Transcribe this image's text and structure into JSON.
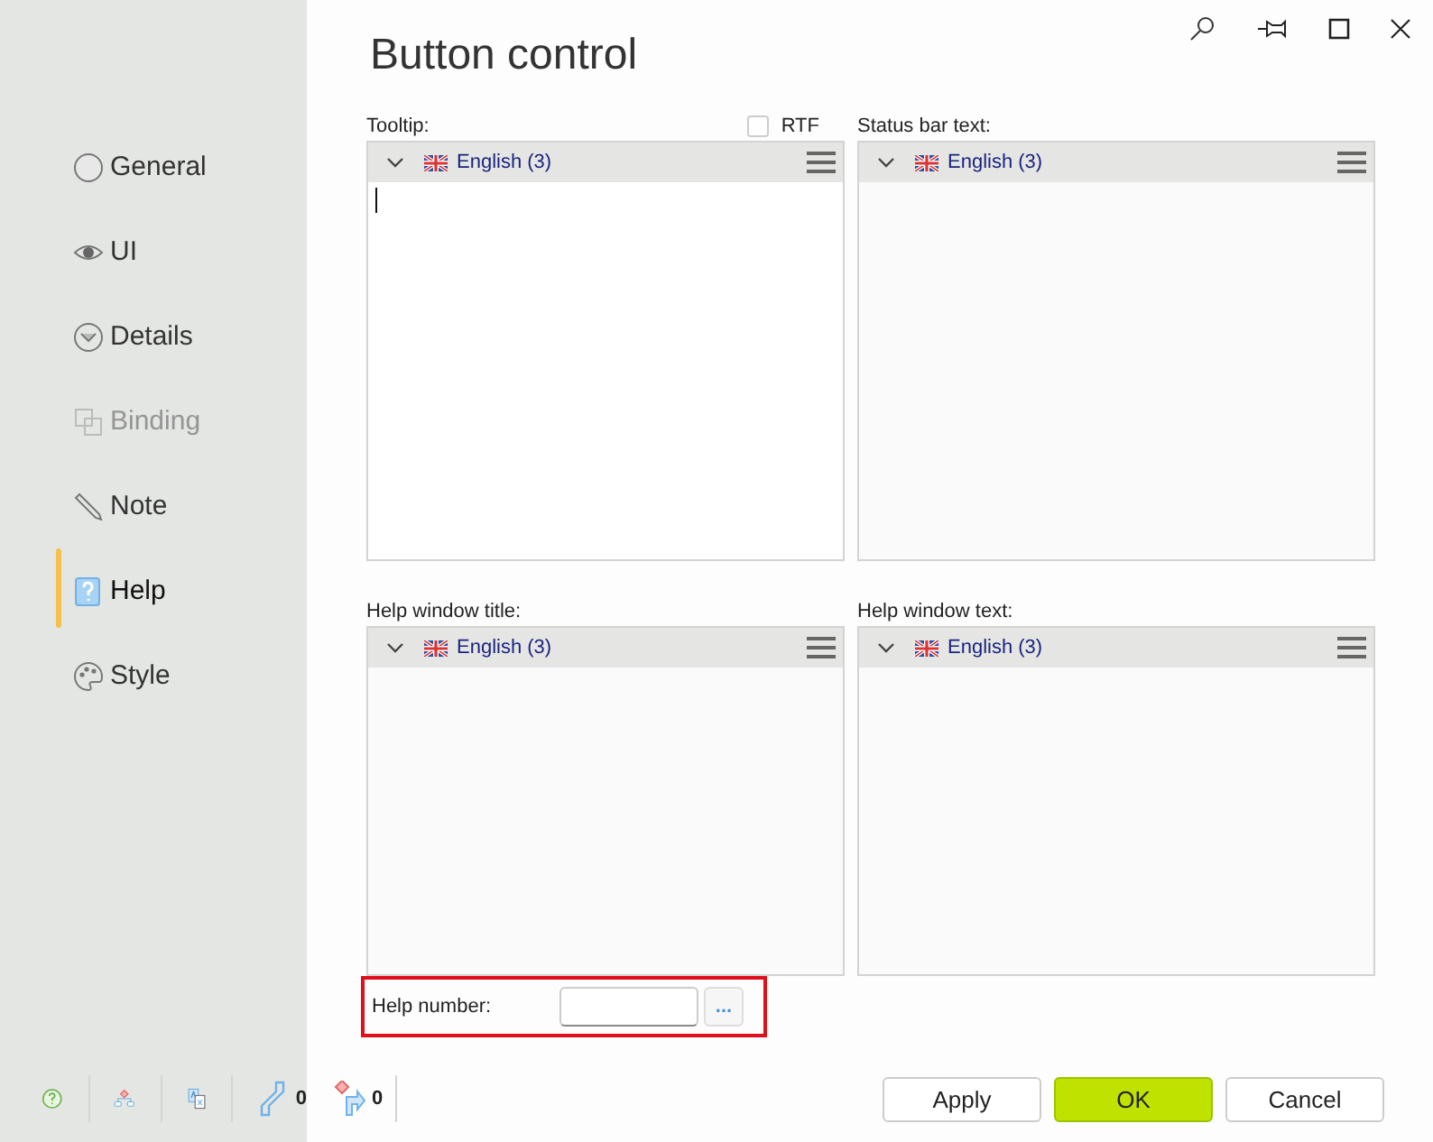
{
  "window": {
    "title": "Button control"
  },
  "sidebar": {
    "items": [
      {
        "label": "General",
        "selected": false,
        "disabled": false
      },
      {
        "label": "UI",
        "selected": false,
        "disabled": false
      },
      {
        "label": "Details",
        "selected": false,
        "disabled": false
      },
      {
        "label": "Binding",
        "selected": false,
        "disabled": true
      },
      {
        "label": "Note",
        "selected": false,
        "disabled": false
      },
      {
        "label": "Help",
        "selected": true,
        "disabled": false
      },
      {
        "label": "Style",
        "selected": false,
        "disabled": false
      }
    ]
  },
  "rtf": {
    "label": "RTF",
    "checked": false
  },
  "editors": [
    {
      "label": "Tooltip:",
      "language": "English (3)",
      "focused": true
    },
    {
      "label": "Status bar text:",
      "language": "English (3)",
      "focused": false
    },
    {
      "label": "Help window title:",
      "language": "English (3)",
      "focused": false
    },
    {
      "label": "Help window text:",
      "language": "English (3)",
      "focused": false
    }
  ],
  "help_number": {
    "label": "Help number:",
    "browse": "...",
    "highlighted": true
  },
  "footer": {
    "counts": [
      "0",
      "0"
    ],
    "buttons": [
      {
        "label": "Apply",
        "kind": "normal"
      },
      {
        "label": "OK",
        "kind": "primary"
      },
      {
        "label": "Cancel",
        "kind": "normal"
      }
    ]
  }
}
